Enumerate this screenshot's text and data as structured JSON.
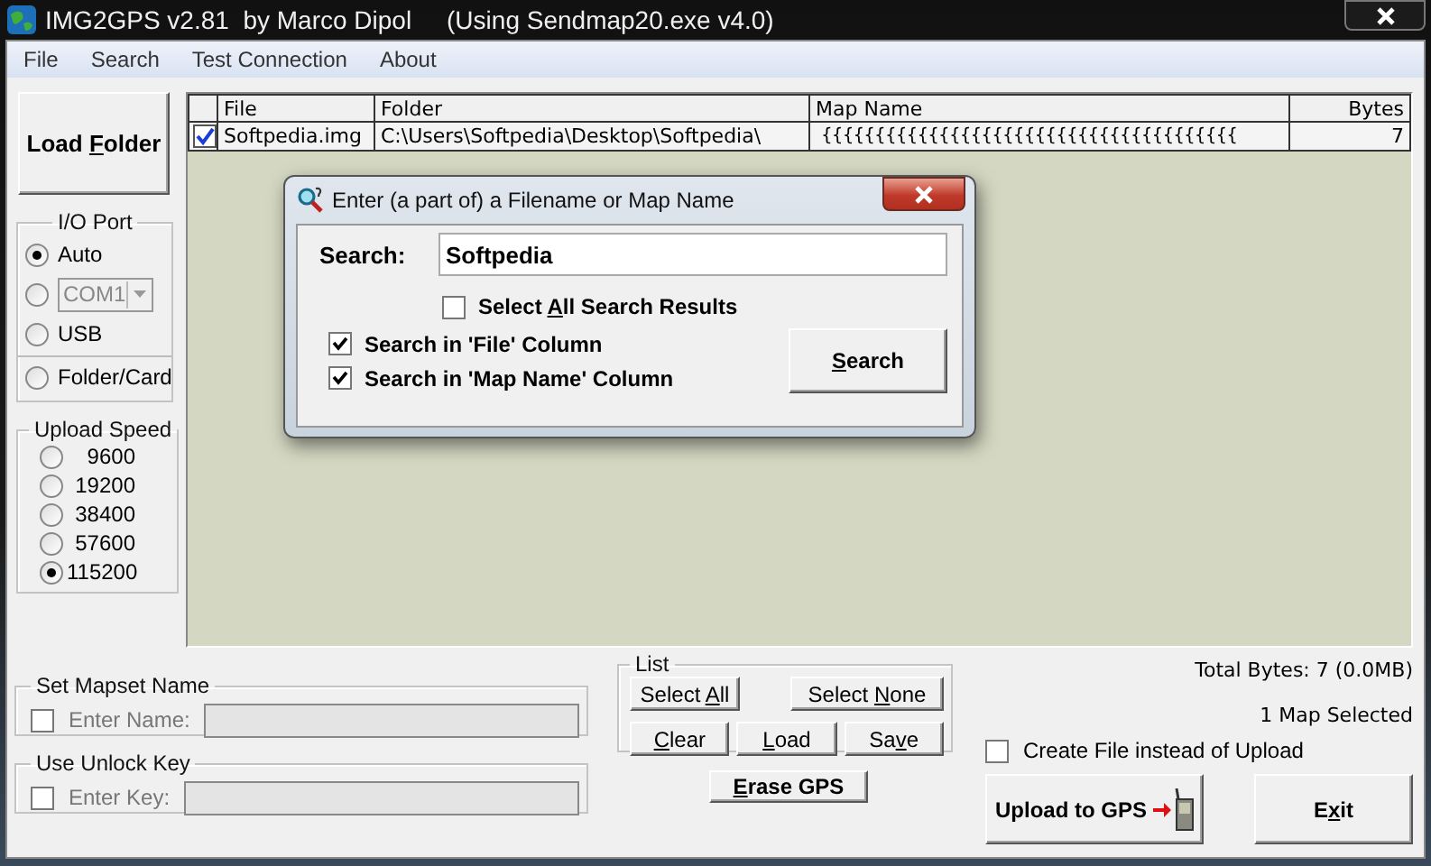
{
  "window": {
    "title": "IMG2GPS v2.81  by Marco Dipol     (Using Sendmap20.exe v4.0)"
  },
  "menu": [
    "File",
    "Search",
    "Test Connection",
    "About"
  ],
  "load_folder_button": {
    "label_parts": [
      {
        "text": "Load ",
        "underlined": false
      },
      {
        "text": "F",
        "underlined": true
      },
      {
        "text": "older",
        "underlined": false
      }
    ]
  },
  "io_port": {
    "title": "I/O Port",
    "options": [
      {
        "kind": "radio",
        "label": "Auto",
        "selected": true,
        "separated": false
      },
      {
        "kind": "combo",
        "value": "COM1",
        "selected": false,
        "separated": false
      },
      {
        "kind": "radio",
        "label": "USB",
        "selected": false,
        "separated": false
      },
      {
        "kind": "radio",
        "label": "Folder/Card",
        "selected": false,
        "separated": true
      }
    ]
  },
  "upload_speed": {
    "title": "Upload Speed",
    "options": [
      {
        "label": "9600",
        "selected": false
      },
      {
        "label": "19200",
        "selected": false
      },
      {
        "label": "38400",
        "selected": false
      },
      {
        "label": "57600",
        "selected": false
      },
      {
        "label": "115200",
        "selected": true
      }
    ]
  },
  "table": {
    "columns": [
      "File",
      "Folder",
      "Map Name",
      "Bytes"
    ],
    "rows": [
      {
        "checked": true,
        "cells": [
          "Softpedia.img",
          "C:\\Users\\Softpedia\\Desktop\\Softpedia\\",
          "{{{{{{{{{{{{{{{{{{{{{{{{{{{{{{{{{{{{{{{",
          "7"
        ]
      }
    ]
  },
  "mapset": {
    "title": "Set Mapset Name",
    "checked": false,
    "field_label": "Enter Name:"
  },
  "unlock_key": {
    "title": "Use Unlock Key",
    "checked": false,
    "field_label": "Enter Key:"
  },
  "list_group": {
    "title": "List",
    "buttons": [
      {
        "label_parts": [
          {
            "text": "Select ",
            "underlined": false
          },
          {
            "text": "A",
            "underlined": true
          },
          {
            "text": "ll",
            "underlined": false
          }
        ]
      },
      {
        "label_parts": [
          {
            "text": "Select ",
            "underlined": false
          },
          {
            "text": "N",
            "underlined": true
          },
          {
            "text": "one",
            "underlined": false
          }
        ]
      },
      {
        "label_parts": [
          {
            "text": "C",
            "underlined": true
          },
          {
            "text": "lear",
            "underlined": false
          }
        ]
      },
      {
        "label_parts": [
          {
            "text": "L",
            "underlined": true
          },
          {
            "text": "oad",
            "underlined": false
          }
        ]
      },
      {
        "label_parts": [
          {
            "text": "Sa",
            "underlined": false
          },
          {
            "text": "v",
            "underlined": true
          },
          {
            "text": "e",
            "underlined": false
          }
        ]
      }
    ]
  },
  "erase_button": {
    "label_parts": [
      {
        "text": "E",
        "underlined": true
      },
      {
        "text": "rase GPS",
        "underlined": false
      }
    ]
  },
  "total_bytes": "Total Bytes: 7 (0.0MB)",
  "selected_count": "1 Map Selected",
  "create_file": {
    "label": "Create File instead of Upload",
    "checked": false
  },
  "upload_button": {
    "label": "Upload to GPS"
  },
  "exit_button": {
    "label_parts": [
      {
        "text": "E",
        "underlined": false
      },
      {
        "text": "x",
        "underlined": true
      },
      {
        "text": "it",
        "underlined": false
      }
    ]
  },
  "dialog": {
    "title": "Enter (a part of) a Filename or Map Name",
    "search_label": "Search:",
    "search_value": "Softpedia",
    "options": [
      {
        "label_parts": [
          {
            "text": "Select ",
            "underlined": false
          },
          {
            "text": "A",
            "underlined": true
          },
          {
            "text": "ll Search Results",
            "underlined": false
          }
        ],
        "checked": false
      },
      {
        "label_parts": [
          {
            "text": "Search in 'File' Column",
            "underlined": false
          }
        ],
        "checked": true
      },
      {
        "label_parts": [
          {
            "text": "Search in 'Map Name' Column",
            "underlined": false
          }
        ],
        "checked": true
      }
    ],
    "search_button": {
      "label_parts": [
        {
          "text": "S",
          "underlined": true
        },
        {
          "text": "earch",
          "underlined": false
        }
      ]
    }
  }
}
